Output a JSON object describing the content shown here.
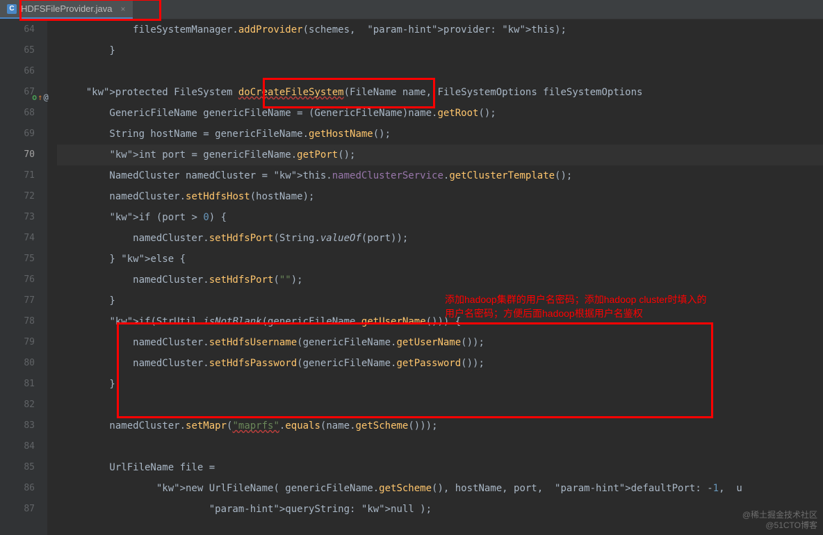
{
  "tab": {
    "icon_letter": "C",
    "filename": "HDFSFileProvider.java",
    "close_glyph": "×"
  },
  "gutter": {
    "start": 64,
    "end": 87,
    "current": 70,
    "override_line": 67
  },
  "code": {
    "l64": "            fileSystemManager.addProvider(schemes,  provider: this);",
    "l65": "        }",
    "l66": "",
    "l67": "    protected FileSystem doCreateFileSystem(FileName name, FileSystemOptions fileSystemOptions",
    "l68": "        GenericFileName genericFileName = (GenericFileName)name.getRoot();",
    "l69": "        String hostName = genericFileName.getHostName();",
    "l70": "        int port = genericFileName.getPort();",
    "l71": "        NamedCluster namedCluster = this.namedClusterService.getClusterTemplate();",
    "l72": "        namedCluster.setHdfsHost(hostName);",
    "l73": "        if (port > 0) {",
    "l74": "            namedCluster.setHdfsPort(String.valueOf(port));",
    "l75": "        } else {",
    "l76": "            namedCluster.setHdfsPort(\"\");",
    "l77": "        }",
    "l78": "        if(StrUtil.isNotBlank(genericFileName.getUserName())) {",
    "l79": "            namedCluster.setHdfsUsername(genericFileName.getUserName());",
    "l80": "            namedCluster.setHdfsPassword(genericFileName.getPassword());",
    "l81": "        }",
    "l82": "",
    "l83": "        namedCluster.setMapr(\"maprfs\".equals(name.getScheme()));",
    "l84": "",
    "l85": "        UrlFileName file =",
    "l86": "                new UrlFileName( genericFileName.getScheme(), hostName, port,  defaultPort: -1,  u",
    "l87": "                         queryString: null );"
  },
  "annotations": {
    "comment_line1": "添加hadoop集群的用户名密码；添加hadoop cluster时填入的",
    "comment_line2": "用户名密码；方便后面hadoop根据用户名鉴权"
  },
  "watermark": {
    "line1": "@稀土掘金技术社区",
    "line2": "@51CTO博客"
  }
}
